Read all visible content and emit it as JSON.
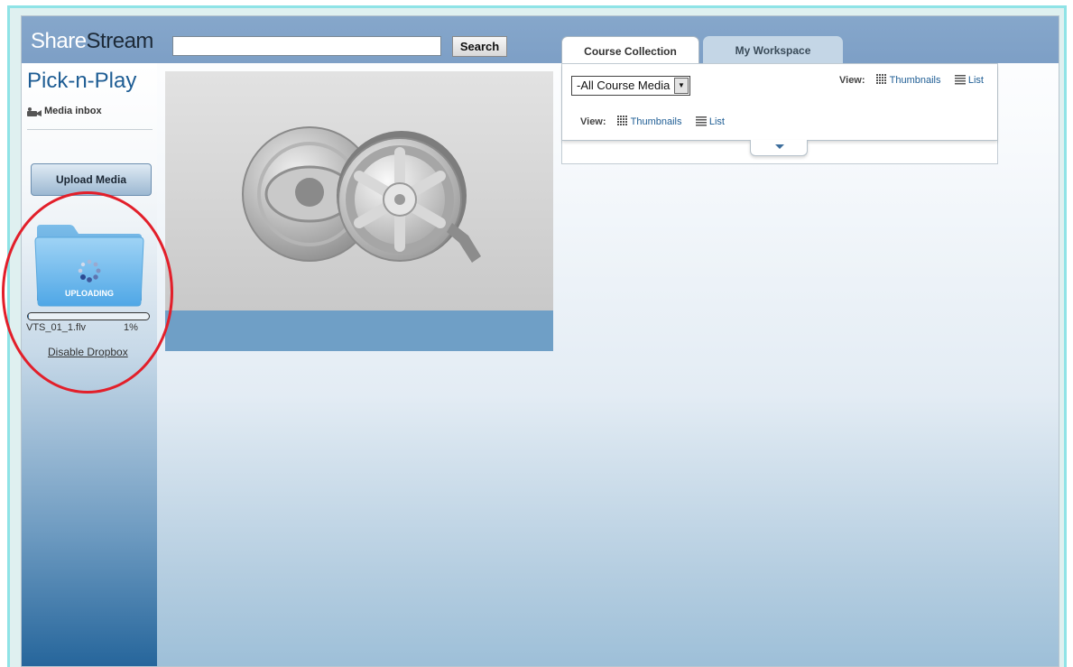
{
  "header": {
    "logo_part1": "Share",
    "logo_part2": "Stream",
    "search_value": "",
    "search_button": "Search"
  },
  "tabs": [
    {
      "label": "Course Collection",
      "active": true
    },
    {
      "label": "My Workspace",
      "active": false
    }
  ],
  "sidebar": {
    "title": "Pick-n-Play",
    "inbox_label": "Media inbox",
    "upload_button": "Upload Media",
    "dropbox": {
      "status": "UPLOADING",
      "filename": "VTS_01_1.flv",
      "percent_text": "1%",
      "progress": 0.01,
      "disable_link": "Disable Dropbox"
    }
  },
  "panel": {
    "media_filter": "-All Course Media",
    "view_label": "View:",
    "thumbnails_label": "Thumbnails",
    "list_label": "List"
  },
  "colors": {
    "accent": "#1e5d94",
    "header": "#7d9fc6",
    "highlight_ring": "#e21f2a"
  },
  "icons": [
    "media-inbox-icon",
    "folder-icon",
    "spinner-icon",
    "speaker-icon",
    "film-reel-icon",
    "grid-icon",
    "list-icon",
    "chevron-down-icon"
  ]
}
